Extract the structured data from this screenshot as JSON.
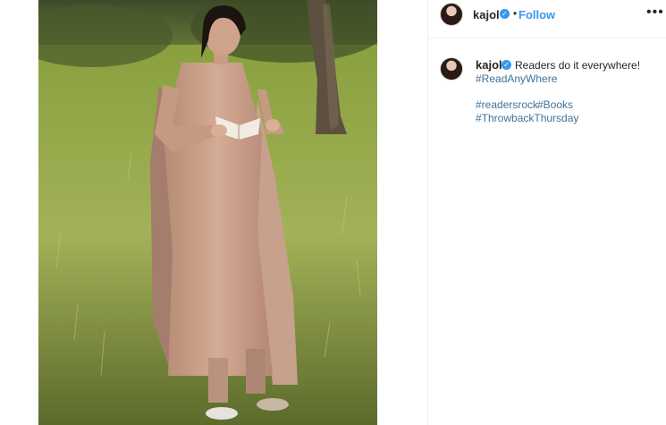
{
  "post": {
    "username": "kajol",
    "follow_label": "Follow",
    "separator": "•",
    "more_label": "•••",
    "verified_mark": "✓",
    "caption": "Readers do it everywhere!",
    "hashtags_line1": "#ReadAnyWhere",
    "hashtags_line2a": "#readersrock",
    "hashtags_line2b": "#Books",
    "hashtags_line3": "#ThrowbackThursday"
  },
  "icons": [
    "verified-badge-icon",
    "more-options-icon",
    "avatar"
  ],
  "colors": {
    "link": "#3897f0",
    "hashtag": "#3f729b",
    "text": "#262626",
    "border": "#efefef"
  }
}
